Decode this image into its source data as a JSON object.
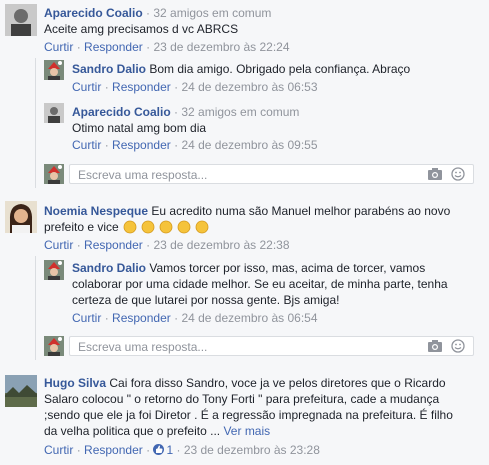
{
  "comments": [
    {
      "name": "Aparecido Coalio",
      "meta": "· 32 amigos em comum",
      "text": "Aceite amg precisamos d vc ABRCS",
      "reply_label": "Curtir",
      "respond_label": "Responder",
      "time": "23 de dezembro às 22:24",
      "replies": [
        {
          "name": "Sandro Dalio",
          "text": "Bom dia amigo. Obrigado pela confiança. Abraço",
          "reply_label": "Curtir",
          "respond_label": "Responder",
          "time": "24 de dezembro às 06:53"
        },
        {
          "name": "Aparecido Coalio",
          "meta": "· 32 amigos em comum",
          "text": "Otimo natal amg bom dia",
          "reply_label": "Curtir",
          "respond_label": "Responder",
          "time": "24 de dezembro às 09:55"
        }
      ],
      "reply_placeholder": "Escreva uma resposta..."
    },
    {
      "name": "Noemia Nespeque",
      "text_line1": "Eu acredito numa são Manuel melhor parabéns ao novo",
      "text_line2": "prefeito e vice",
      "reply_label": "Curtir",
      "respond_label": "Responder",
      "time": "23 de dezembro às 22:38",
      "replies": [
        {
          "name": "Sandro Dalio",
          "text_line1": "Vamos torcer por isso, mas, acima de torcer, vamos",
          "text_line2": "colaborar por uma cidade melhor. Se eu aceitar, de minha parte, tenha",
          "text_line3": "certeza de que lutarei por nossa gente. Bjs amiga!",
          "reply_label": "Curtir",
          "respond_label": "Responder",
          "time": "24 de dezembro às 06:54"
        }
      ],
      "reply_placeholder": "Escreva uma resposta..."
    },
    {
      "name": "Hugo Silva",
      "text_line1": "Cai fora disso Sandro, voce ja ve pelos diretores que o Ricardo",
      "text_line2": "Salaro colocou \" o retorno do Tony Forti \" para prefeitura, cade a mudança",
      "text_line3": ";sendo que ele ja foi Diretor . É a regressão impregnada na prefeitura. É filho",
      "text_line4": "da velha politica que o prefeito ...",
      "more_label": "Ver mais",
      "reply_label": "Curtir",
      "respond_label": "Responder",
      "likes": "1",
      "time": "23 de dezembro às 23:28"
    }
  ],
  "colors": {
    "link": "#4267b2",
    "name": "#365899",
    "muted": "#90949c",
    "background": "#f6f7f9"
  }
}
